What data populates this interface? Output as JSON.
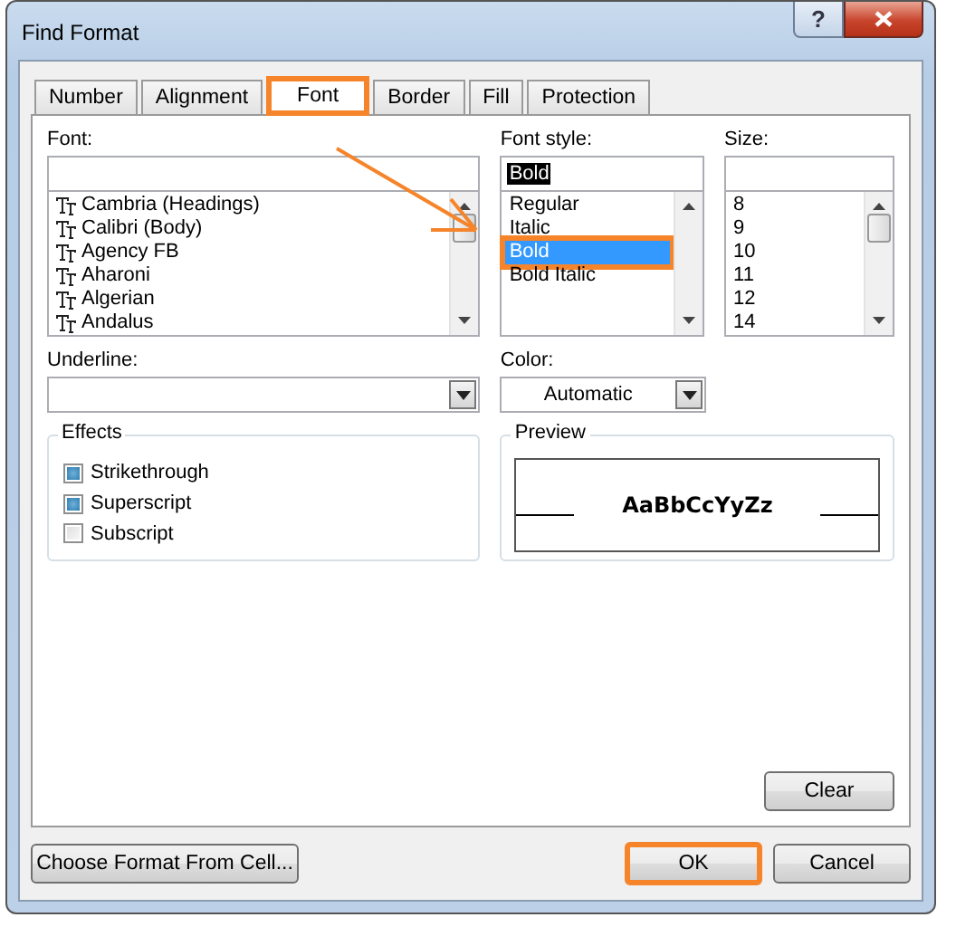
{
  "window": {
    "title": "Find Format",
    "help": "?"
  },
  "tabs": [
    {
      "label": "Number",
      "selected": false,
      "highlighted": false
    },
    {
      "label": "Alignment",
      "selected": false,
      "highlighted": false
    },
    {
      "label": "Font",
      "selected": true,
      "highlighted": true
    },
    {
      "label": "Border",
      "selected": false,
      "highlighted": false
    },
    {
      "label": "Fill",
      "selected": false,
      "highlighted": false
    },
    {
      "label": "Protection",
      "selected": false,
      "highlighted": false
    }
  ],
  "font": {
    "label": "Font:",
    "items": [
      {
        "label": "Cambria (Headings)",
        "selected": false
      },
      {
        "label": "Calibri (Body)",
        "selected": false
      },
      {
        "label": "Agency FB",
        "selected": false
      },
      {
        "label": "Aharoni",
        "selected": false
      },
      {
        "label": "Algerian",
        "selected": false
      },
      {
        "label": "Andalus",
        "selected": false
      }
    ]
  },
  "font_style": {
    "label": "Font style:",
    "value": "Bold",
    "items": [
      {
        "label": "Regular",
        "selected": false,
        "highlighted": false
      },
      {
        "label": "Italic",
        "selected": false,
        "highlighted": false
      },
      {
        "label": "Bold",
        "selected": true,
        "highlighted": true
      },
      {
        "label": "Bold Italic",
        "selected": false,
        "highlighted": false
      }
    ]
  },
  "size": {
    "label": "Size:",
    "items": [
      {
        "label": "8",
        "selected": false
      },
      {
        "label": "9",
        "selected": false
      },
      {
        "label": "10",
        "selected": false
      },
      {
        "label": "11",
        "selected": false
      },
      {
        "label": "12",
        "selected": false
      },
      {
        "label": "14",
        "selected": false
      }
    ]
  },
  "underline": {
    "label": "Underline:"
  },
  "color": {
    "label": "Color:",
    "value": "Automatic"
  },
  "effects": {
    "title": "Effects",
    "items": [
      {
        "label": "Strikethrough",
        "checked": true
      },
      {
        "label": "Superscript",
        "checked": true
      },
      {
        "label": "Subscript",
        "checked": false
      }
    ]
  },
  "preview": {
    "title": "Preview",
    "sample": "AaBbCcYyZz"
  },
  "clear_button": "Clear",
  "footer_buttons": [
    {
      "label": "Choose Format From Cell...",
      "highlighted": false
    },
    {
      "label": "OK",
      "highlighted": true
    },
    {
      "label": "Cancel",
      "highlighted": false
    }
  ]
}
